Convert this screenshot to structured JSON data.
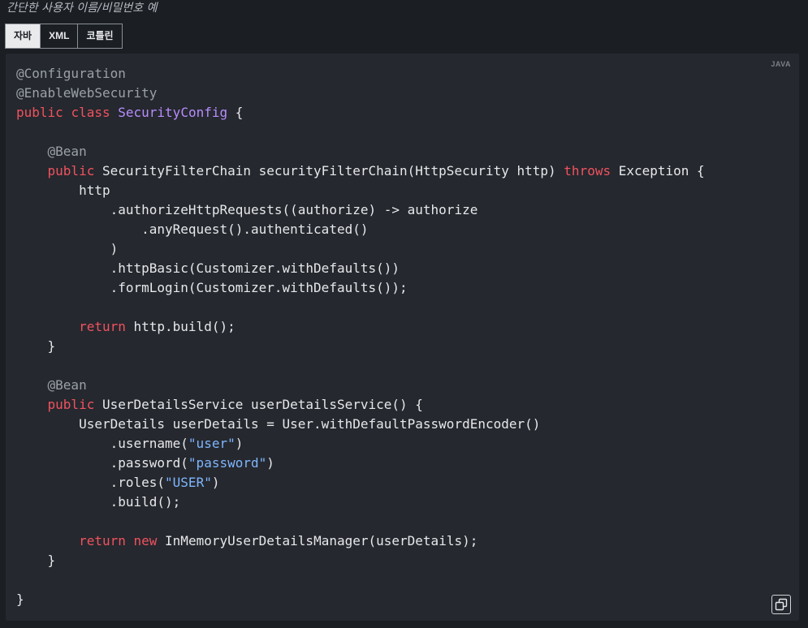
{
  "caption": "간단한 사용자 이름/비밀번호 예",
  "tabs": [
    {
      "label": "자바",
      "active": true
    },
    {
      "label": "XML",
      "active": false
    },
    {
      "label": "코틀린",
      "active": false
    }
  ],
  "code_block": {
    "language_label": "JAVA",
    "copy_icon": "copy-icon",
    "colors": {
      "background": "#25282e",
      "annotation": "#9ba0a8",
      "keyword": "#f0525f",
      "class_name": "#b88cff",
      "string": "#7fb6ff",
      "plain": "#e6e8eb"
    },
    "lines": [
      [
        {
          "t": "annotation",
          "v": "@Configuration"
        }
      ],
      [
        {
          "t": "annotation",
          "v": "@EnableWebSecurity"
        }
      ],
      [
        {
          "t": "keyword",
          "v": "public"
        },
        {
          "t": "plain",
          "v": " "
        },
        {
          "t": "keyword",
          "v": "class"
        },
        {
          "t": "plain",
          "v": " "
        },
        {
          "t": "class",
          "v": "SecurityConfig"
        },
        {
          "t": "plain",
          "v": " {"
        }
      ],
      [],
      [
        {
          "t": "plain",
          "v": "    "
        },
        {
          "t": "annotation",
          "v": "@Bean"
        }
      ],
      [
        {
          "t": "plain",
          "v": "    "
        },
        {
          "t": "keyword",
          "v": "public"
        },
        {
          "t": "plain",
          "v": " SecurityFilterChain securityFilterChain(HttpSecurity http) "
        },
        {
          "t": "keyword",
          "v": "throws"
        },
        {
          "t": "plain",
          "v": " Exception {"
        }
      ],
      [
        {
          "t": "plain",
          "v": "        http"
        }
      ],
      [
        {
          "t": "plain",
          "v": "            .authorizeHttpRequests((authorize) -> authorize"
        }
      ],
      [
        {
          "t": "plain",
          "v": "                .anyRequest().authenticated()"
        }
      ],
      [
        {
          "t": "plain",
          "v": "            )"
        }
      ],
      [
        {
          "t": "plain",
          "v": "            .httpBasic(Customizer.withDefaults())"
        }
      ],
      [
        {
          "t": "plain",
          "v": "            .formLogin(Customizer.withDefaults());"
        }
      ],
      [],
      [
        {
          "t": "plain",
          "v": "        "
        },
        {
          "t": "keyword",
          "v": "return"
        },
        {
          "t": "plain",
          "v": " http.build();"
        }
      ],
      [
        {
          "t": "plain",
          "v": "    }"
        }
      ],
      [],
      [
        {
          "t": "plain",
          "v": "    "
        },
        {
          "t": "annotation",
          "v": "@Bean"
        }
      ],
      [
        {
          "t": "plain",
          "v": "    "
        },
        {
          "t": "keyword",
          "v": "public"
        },
        {
          "t": "plain",
          "v": " UserDetailsService userDetailsService() {"
        }
      ],
      [
        {
          "t": "plain",
          "v": "        UserDetails userDetails = User.withDefaultPasswordEncoder()"
        }
      ],
      [
        {
          "t": "plain",
          "v": "            .username("
        },
        {
          "t": "string",
          "v": "\"user\""
        },
        {
          "t": "plain",
          "v": ")"
        }
      ],
      [
        {
          "t": "plain",
          "v": "            .password("
        },
        {
          "t": "string",
          "v": "\"password\""
        },
        {
          "t": "plain",
          "v": ")"
        }
      ],
      [
        {
          "t": "plain",
          "v": "            .roles("
        },
        {
          "t": "string",
          "v": "\"USER\""
        },
        {
          "t": "plain",
          "v": ")"
        }
      ],
      [
        {
          "t": "plain",
          "v": "            .build();"
        }
      ],
      [],
      [
        {
          "t": "plain",
          "v": "        "
        },
        {
          "t": "keyword",
          "v": "return"
        },
        {
          "t": "plain",
          "v": " "
        },
        {
          "t": "keyword",
          "v": "new"
        },
        {
          "t": "plain",
          "v": " InMemoryUserDetailsManager(userDetails);"
        }
      ],
      [
        {
          "t": "plain",
          "v": "    }"
        }
      ],
      [],
      [
        {
          "t": "plain",
          "v": "}"
        }
      ]
    ]
  }
}
